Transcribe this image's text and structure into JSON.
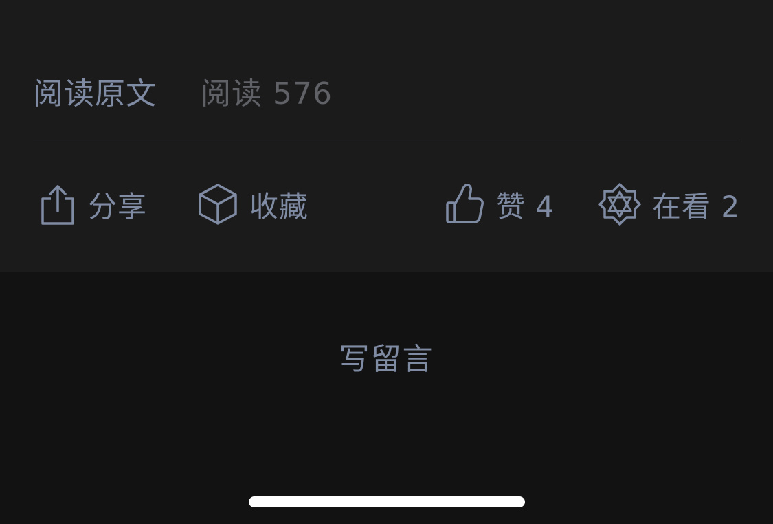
{
  "article_footer": {
    "read_original_label": "阅读原文",
    "read_count_label": "阅读 576"
  },
  "actions": {
    "share": {
      "label": "分享",
      "icon": "share-icon"
    },
    "collect": {
      "label": "收藏",
      "icon": "cube-icon"
    },
    "like": {
      "label": "赞 4",
      "icon": "thumbs-up-icon"
    },
    "watching": {
      "label": "在看 2",
      "icon": "wow-star-icon"
    }
  },
  "comments": {
    "write_label": "写留言"
  },
  "colors": {
    "label": "#7f8ba3",
    "muted": "#5f6166",
    "panel": "#1b1b1c",
    "background": "#121212"
  }
}
